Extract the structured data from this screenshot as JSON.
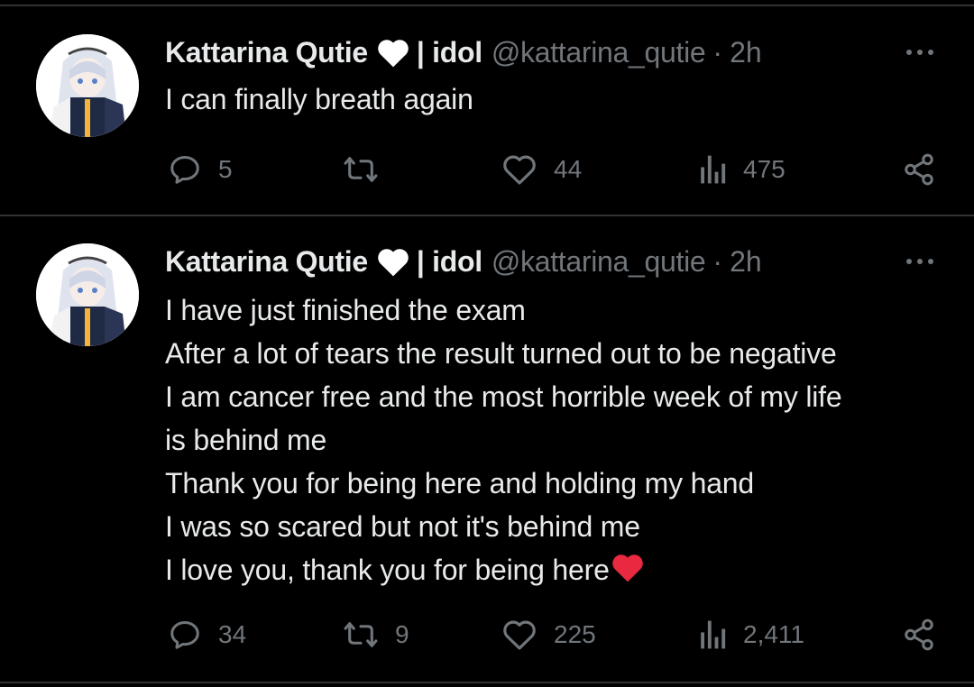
{
  "colors": {
    "background": "#000000",
    "text_primary": "#e7e9ea",
    "text_secondary": "#71767b",
    "divider": "#2f3336",
    "heart_red": "#f91880"
  },
  "tweets": [
    {
      "author_name": "Kattarina Qutie",
      "author_badge_icon": "white-heart-icon",
      "author_suffix": "| idol",
      "handle": "@kattarina_qutie",
      "separator": "·",
      "time": "2h",
      "lines": [
        "I can finally breath again"
      ],
      "replies": "5",
      "reposts": "",
      "likes": "44",
      "views": "475"
    },
    {
      "author_name": "Kattarina Qutie",
      "author_badge_icon": "white-heart-icon",
      "author_suffix": "| idol",
      "handle": "@kattarina_qutie",
      "separator": "·",
      "time": "2h",
      "lines": [
        "I have just finished the exam",
        "After a lot of tears the result turned out to be negative",
        "I am cancer free and the most horrible week of my life",
        "is behind me",
        "Thank you for being here and holding my hand",
        "I was so scared but not it's behind me",
        "I love you, thank you for being here"
      ],
      "trailing_emoji_icon": "red-heart-icon",
      "replies": "34",
      "reposts": "9",
      "likes": "225",
      "views": "2,411"
    }
  ]
}
